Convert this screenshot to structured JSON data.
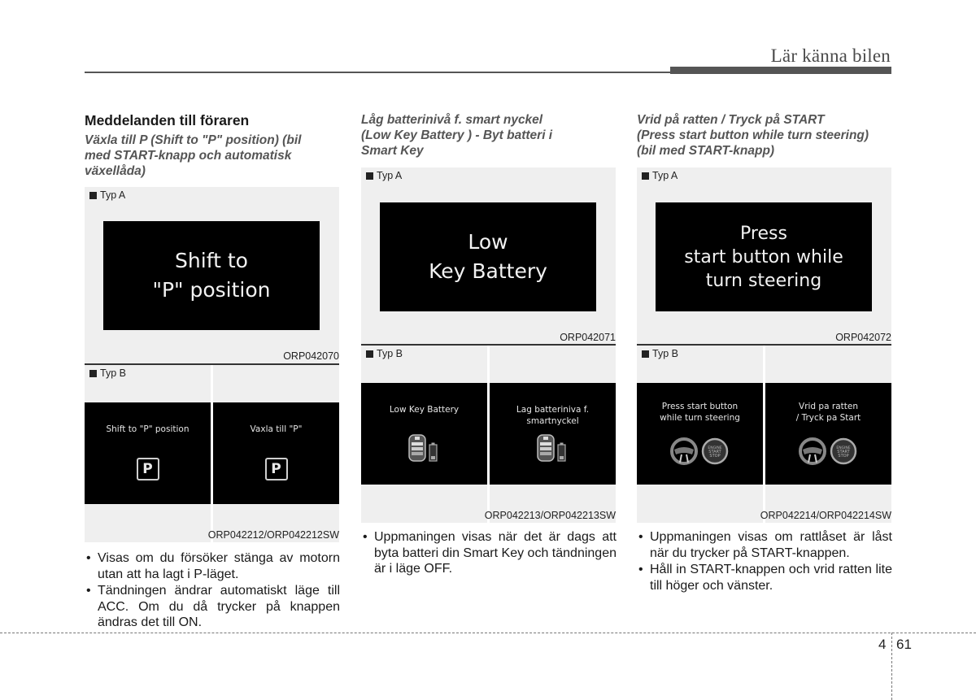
{
  "header": {
    "chapter_title": "Lär känna bilen"
  },
  "columns": [
    {
      "section_title": "Meddelanden till föraren",
      "subtitle": [
        "Växla till P (Shift to \"P\" position) (bil",
        "med START-knapp och automatisk",
        "växellåda)"
      ],
      "figure_a": {
        "label": "Typ A",
        "screen_lines": [
          "Shift to",
          "\"P\" position"
        ],
        "code": "ORP042070"
      },
      "figure_b": {
        "label": "Typ B",
        "left": {
          "lines": [
            "Shift to \"P\" position"
          ],
          "icon": "park-p-icon",
          "icon_text": "P"
        },
        "right": {
          "lines": [
            "Vaxla till \"P\""
          ],
          "icon": "park-p-icon",
          "icon_text": "P"
        },
        "code": "ORP042212/ORP042212SW"
      },
      "bullets": [
        "Visas om du försöker stänga av motorn utan att ha lagt i P-läget.",
        "Tändningen ändrar automatiskt läge till ACC. Om du då trycker på knappen ändras det till ON."
      ]
    },
    {
      "subtitle": [
        "Låg batterinivå f. smart nyckel",
        "(Low Key Battery ) - Byt batteri i",
        "Smart Key"
      ],
      "figure_a": {
        "label": "Typ A",
        "screen_lines": [
          "Low",
          "Key Battery"
        ],
        "code": "ORP042071"
      },
      "figure_b": {
        "label": "Typ B",
        "left": {
          "lines": [
            "Low Key Battery"
          ],
          "icon": "smart-key-battery-icon"
        },
        "right": {
          "lines": [
            "Lag batteriniva f.",
            "smartnyckel"
          ],
          "icon": "smart-key-battery-icon"
        },
        "code": "ORP042213/ORP042213SW"
      },
      "bullets": [
        "Uppmaningen visas när det är dags att byta batteri din Smart Key och tändningen är i läge OFF."
      ]
    },
    {
      "subtitle": [
        "Vrid på ratten / Tryck på START",
        "(Press start button while turn steering)",
        "(bil med START-knapp)"
      ],
      "figure_a": {
        "label": "Typ A",
        "screen_lines": [
          "Press",
          "start button while",
          "turn steering"
        ],
        "code": "ORP042072"
      },
      "figure_b": {
        "label": "Typ B",
        "left": {
          "lines": [
            "Press start button",
            "while turn steering"
          ],
          "icon": "steering-wheel-start-button-icon"
        },
        "right": {
          "lines": [
            "Vrid pa ratten",
            "/ Tryck pa Start"
          ],
          "icon": "steering-wheel-start-button-icon"
        },
        "code": "ORP042214/ORP042214SW"
      },
      "bullets": [
        "Uppmaningen visas om rattlåset är låst när du trycker på START-knappen.",
        "Håll in START-knappen och vrid ratten lite till höger och vänster."
      ]
    }
  ],
  "footer": {
    "chapter": "4",
    "page": "61"
  }
}
